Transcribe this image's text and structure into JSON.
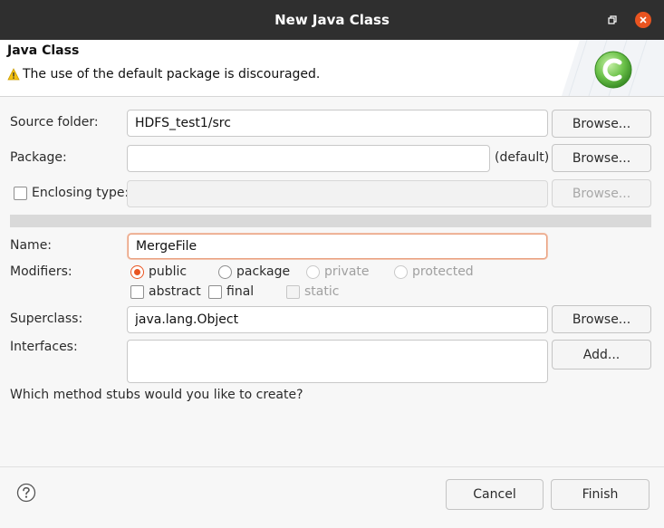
{
  "window": {
    "title": "New Java Class"
  },
  "header": {
    "title": "Java Class",
    "warning": "The use of the default package is discouraged."
  },
  "form": {
    "source_folder": {
      "label": "Source folder:",
      "value": "HDFS_test1/src",
      "browse": "Browse..."
    },
    "package": {
      "label": "Package:",
      "value": "",
      "suffix": "(default)",
      "browse": "Browse..."
    },
    "enclosing_type": {
      "label": "Enclosing type:",
      "checked": false,
      "value": "",
      "browse": "Browse..."
    },
    "name": {
      "label": "Name:",
      "value": "MergeFile"
    },
    "modifiers": {
      "label": "Modifiers:",
      "access": [
        {
          "label": "public",
          "checked": true,
          "enabled": true
        },
        {
          "label": "package",
          "checked": false,
          "enabled": true
        },
        {
          "label": "private",
          "checked": false,
          "enabled": false
        },
        {
          "label": "protected",
          "checked": false,
          "enabled": false
        }
      ],
      "flags": [
        {
          "label": "abstract",
          "checked": false,
          "enabled": true
        },
        {
          "label": "final",
          "checked": false,
          "enabled": true
        },
        {
          "label": "static",
          "checked": false,
          "enabled": false
        }
      ]
    },
    "superclass": {
      "label": "Superclass:",
      "value": "java.lang.Object",
      "browse": "Browse..."
    },
    "interfaces": {
      "label": "Interfaces:",
      "add": "Add..."
    },
    "stubs_question": "Which method stubs would you like to create?"
  },
  "footer": {
    "cancel": "Cancel",
    "finish": "Finish"
  },
  "colors": {
    "accent": "#e95420",
    "titlebar": "#2f2f2f",
    "logo": "#6cc24a"
  },
  "icons": {
    "warning": "warning-icon",
    "help": "help-icon",
    "logo": "java-class-logo-icon"
  }
}
